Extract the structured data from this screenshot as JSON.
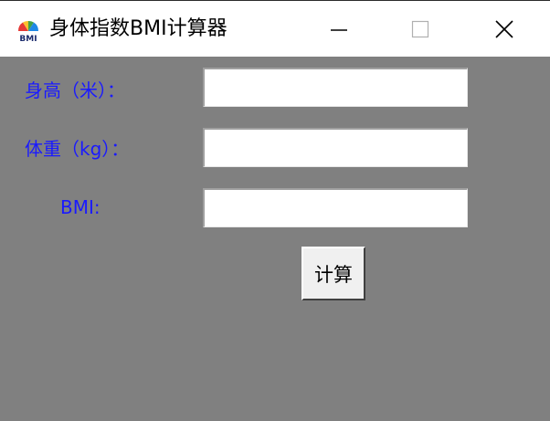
{
  "window": {
    "title": "身体指数BMI计算器",
    "icon": "bmi-gauge-icon",
    "icon_text": "BMI"
  },
  "form": {
    "height_label": "身高（米）：",
    "weight_label": "体重（kg）：",
    "bmi_label": "BMI:",
    "height_value": "",
    "weight_value": "",
    "bmi_value": ""
  },
  "actions": {
    "calculate_label": "计算"
  },
  "colors": {
    "background": "#808080",
    "label": "#1a1aff",
    "titlebar": "#ffffff"
  }
}
